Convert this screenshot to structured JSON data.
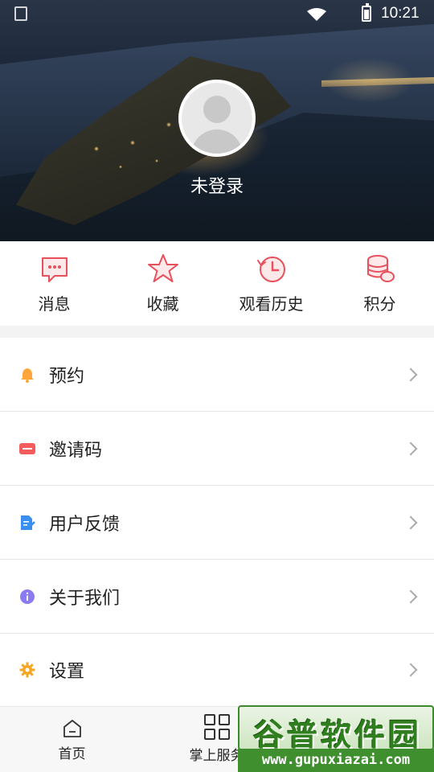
{
  "status_bar": {
    "time": "10:21"
  },
  "profile": {
    "login_status": "未登录"
  },
  "quick_actions": [
    {
      "label": "消息",
      "icon": "message-icon"
    },
    {
      "label": "收藏",
      "icon": "star-icon"
    },
    {
      "label": "观看历史",
      "icon": "history-icon"
    },
    {
      "label": "积分",
      "icon": "coins-icon"
    }
  ],
  "menu": [
    {
      "label": "预约",
      "icon": "bell-icon",
      "color": "#ffa63a"
    },
    {
      "label": "邀请码",
      "icon": "ticket-icon",
      "color": "#f25c5c"
    },
    {
      "label": "用户反馈",
      "icon": "feedback-icon",
      "color": "#3a8ef0"
    },
    {
      "label": "关于我们",
      "icon": "info-icon",
      "color": "#8a7bf2"
    },
    {
      "label": "设置",
      "icon": "gear-icon",
      "color": "#f5a623"
    }
  ],
  "bottom_nav": [
    {
      "label": "首页",
      "icon": "home-icon"
    },
    {
      "label": "掌上服务",
      "icon": "grid-icon"
    }
  ],
  "watermark": {
    "title": "谷普软件园",
    "url": "www.gupuxiazai.com"
  },
  "colors": {
    "accent": "#e8505b",
    "watermark_green": "#3f8f2e"
  }
}
